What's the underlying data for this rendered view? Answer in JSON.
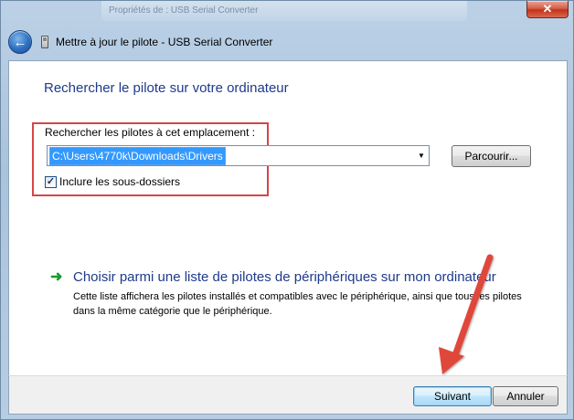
{
  "background": {
    "ghost_title": "Propriétés de : USB Serial Converter"
  },
  "window": {
    "close_label": "✕",
    "title": "Mettre à jour le pilote - USB Serial Converter"
  },
  "main": {
    "heading": "Rechercher le pilote sur votre ordinateur",
    "search_label": "Rechercher les pilotes à cet emplacement :",
    "path_value": "C:\\Users\\4770k\\Downloads\\Drivers",
    "browse_label": "Parcourir...",
    "include_subfolders_label": "Inclure les sous-dossiers",
    "include_subfolders_checked": true,
    "choose_title": "Choisir parmi une liste de pilotes de périphériques sur mon ordinateur",
    "choose_desc": "Cette liste affichera les pilotes installés et compatibles avec le périphérique, ainsi que tous les pilotes dans la même catégorie que le périphérique."
  },
  "footer": {
    "next_label": "Suivant",
    "cancel_label": "Annuler"
  },
  "colors": {
    "heading": "#1e3a8a",
    "highlight_box": "#d64545",
    "annotation_arrow": "#e0463b",
    "selection": "#3399ff"
  },
  "icons": {
    "back": "back-arrow-icon",
    "device": "usb-device-icon",
    "choose": "green-arrow-icon",
    "dropdown": "chevron-down-icon",
    "check": "checkmark-icon"
  }
}
